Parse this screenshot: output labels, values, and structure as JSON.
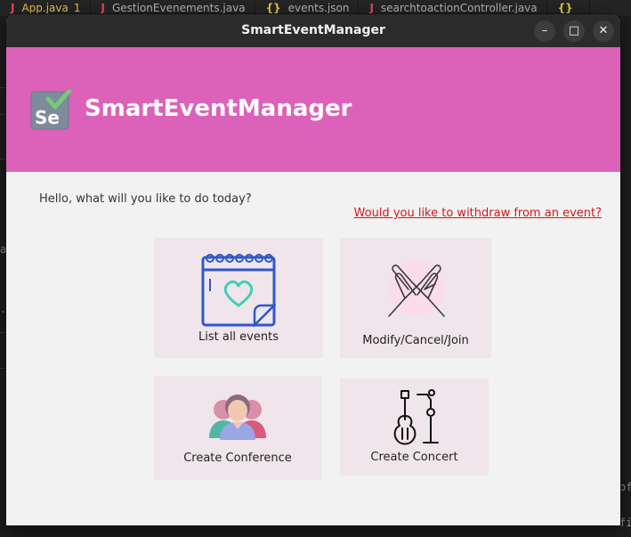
{
  "editor": {
    "tabs": [
      {
        "icon": "java-file-icon",
        "glyph": "J",
        "label": "App.java",
        "badge": "1"
      },
      {
        "icon": "java-file-icon",
        "glyph": "J",
        "label": "GestionEvenements.java"
      },
      {
        "icon": "json-file-icon",
        "glyph": "{}",
        "label": "events.json"
      },
      {
        "icon": "java-file-icon",
        "glyph": "J",
        "label": "searchtoactionController.java"
      },
      {
        "icon": "json-file-icon",
        "glyph": "{}",
        "label": ""
      }
    ],
    "fragments": [
      "a",
      ".",
      "of",
      "fi"
    ]
  },
  "window": {
    "title": "SmartEventManager",
    "controls": {
      "minimize": "–",
      "maximize": "□",
      "close": "✕"
    }
  },
  "header": {
    "logo_text": "Se",
    "app_name": "SmartEventManager",
    "color": "#dc62b9"
  },
  "main": {
    "greeting": "Hello, what will you like to do today?",
    "withdraw_link": "Would you like to withdraw from an event?",
    "cards": {
      "list": {
        "label": "List all events",
        "icon": "calendar-heart-icon"
      },
      "modify": {
        "label": "Modify/Cancel/Join",
        "icon": "crossed-hands-icon"
      },
      "conference": {
        "label": "Create Conference",
        "icon": "people-group-icon"
      },
      "concert": {
        "label": "Create Concert",
        "icon": "guitar-microphone-icon"
      }
    }
  }
}
